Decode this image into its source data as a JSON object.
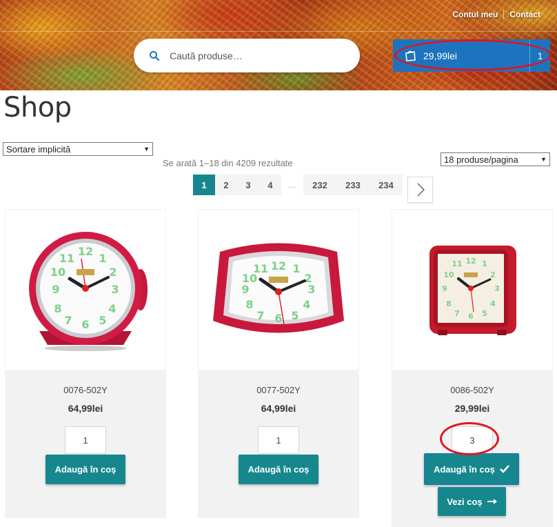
{
  "header": {
    "links": [
      "Contul meu",
      "Contact"
    ],
    "search": {
      "placeholder": "Caută produse…"
    },
    "cart": {
      "total": "29,99lei",
      "count": "1"
    }
  },
  "page": {
    "title": "Shop",
    "sort": {
      "selected": "Sortare implicită"
    },
    "results_text": "Se arată 1–18 din 4209 rezultate",
    "per_page": {
      "selected": "18 produse/pagina"
    },
    "pagination": [
      "1",
      "2",
      "3",
      "4",
      "…",
      "232",
      "233",
      "234"
    ]
  },
  "products": [
    {
      "sku": "0076-502Y",
      "price": "64,99lei",
      "qty": "1",
      "button": "Adaugă în coș"
    },
    {
      "sku": "0077-502Y",
      "price": "64,99lei",
      "qty": "1",
      "button": "Adaugă în coș"
    },
    {
      "sku": "0086-502Y",
      "price": "29,99lei",
      "qty": "3",
      "button": "Adaugă în coș",
      "view_cart": "Vezi coș"
    }
  ],
  "colors": {
    "accent": "#17878e",
    "cart_bg": "#1e73be",
    "highlight": "#e0151c"
  }
}
